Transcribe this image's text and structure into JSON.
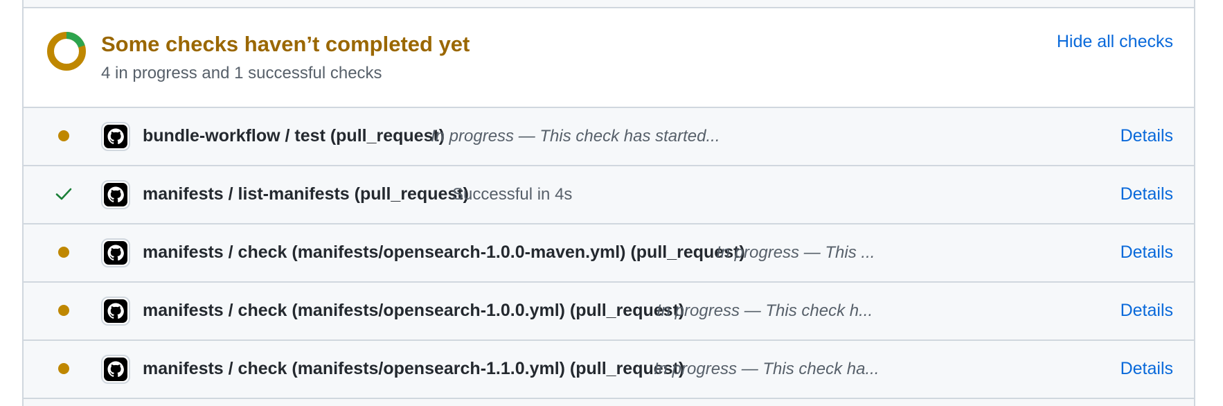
{
  "header": {
    "title": "Some checks haven’t completed yet",
    "subtitle": "4 in progress and 1 successful checks",
    "hide_label": "Hide all checks",
    "ring_progress": 0.2,
    "colors": {
      "pending": "#bf8700",
      "success": "#2da44e"
    }
  },
  "checks": [
    {
      "status": "in_progress",
      "status_icon": "pending-dot-icon",
      "app_icon": "github-icon",
      "name": "bundle-workflow / test (pull_request)",
      "description": "In progress — This check has started...",
      "details_label": "Details"
    },
    {
      "status": "success",
      "status_icon": "checkmark-icon",
      "app_icon": "github-icon",
      "name": "manifests / list-manifests (pull_request)",
      "description": "Successful in 4s",
      "details_label": "Details"
    },
    {
      "status": "in_progress",
      "status_icon": "pending-dot-icon",
      "app_icon": "github-icon",
      "name": "manifests / check (manifests/opensearch-1.0.0-maven.yml) (pull_request)",
      "description": "In progress — This ...",
      "details_label": "Details"
    },
    {
      "status": "in_progress",
      "status_icon": "pending-dot-icon",
      "app_icon": "github-icon",
      "name": "manifests / check (manifests/opensearch-1.0.0.yml) (pull_request)",
      "description": "In progress — This check h...",
      "details_label": "Details"
    },
    {
      "status": "in_progress",
      "status_icon": "pending-dot-icon",
      "app_icon": "github-icon",
      "name": "manifests / check (manifests/opensearch-1.1.0.yml) (pull_request)",
      "description": "In progress — This check ha...",
      "details_label": "Details"
    }
  ]
}
